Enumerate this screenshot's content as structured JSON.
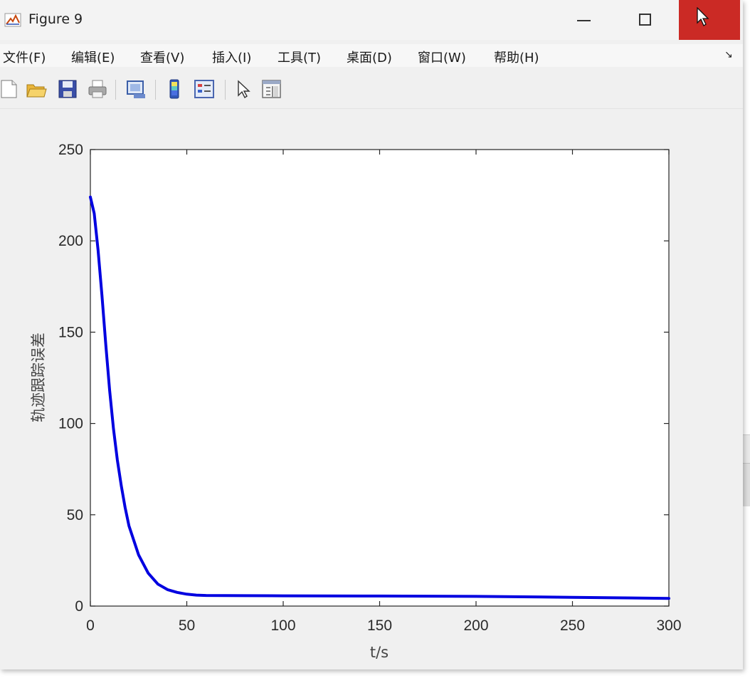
{
  "window": {
    "title": "Figure 9",
    "close_color": "#cb2a25"
  },
  "menu": {
    "items": [
      "文件(F)",
      "编辑(E)",
      "查看(V)",
      "插入(I)",
      "工具(T)",
      "桌面(D)",
      "窗口(W)",
      "帮助(H)"
    ],
    "overflow_icon": "menu-overflow-arrow"
  },
  "toolbar": {
    "buttons": [
      "new-figure-icon",
      "open-icon",
      "save-icon",
      "print-icon",
      "link-plot-icon",
      "insert-colorbar-icon",
      "insert-legend-icon",
      "edit-plot-arrow-icon",
      "property-inspector-icon"
    ]
  },
  "chart_data": {
    "type": "line",
    "xlabel": "t/s",
    "ylabel": "轨迹跟踪误差",
    "xlim": [
      0,
      300
    ],
    "ylim": [
      0,
      250
    ],
    "xticks": [
      0,
      50,
      100,
      150,
      200,
      250,
      300
    ],
    "yticks": [
      0,
      50,
      100,
      150,
      200,
      250
    ],
    "grid": false,
    "series": [
      {
        "color": "#0000e0",
        "x": [
          0,
          2,
          4,
          6,
          8,
          10,
          12,
          14,
          16,
          18,
          20,
          25,
          30,
          35,
          40,
          45,
          50,
          55,
          60,
          80,
          100,
          150,
          200,
          250,
          300
        ],
        "y": [
          224,
          215,
          195,
          170,
          143,
          118,
          97,
          80,
          66,
          54,
          44,
          28,
          18,
          12,
          9,
          7.5,
          6.5,
          6,
          5.8,
          5.7,
          5.6,
          5.5,
          5.3,
          4.8,
          4.2
        ]
      }
    ]
  }
}
